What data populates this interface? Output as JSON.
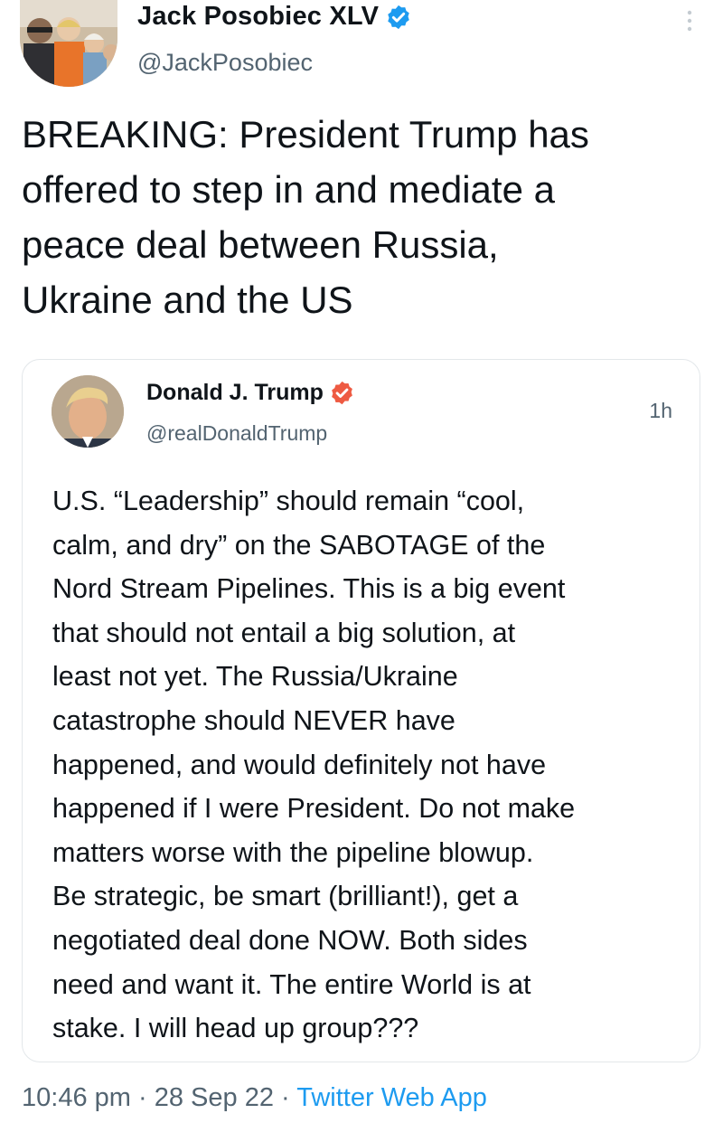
{
  "author": {
    "display_name": "Jack Posobiec XLV",
    "handle": "@JackPosobiec",
    "verified_icon": "verified-badge-icon"
  },
  "tweet": {
    "text": "BREAKING: President Trump has\noffered to step in and mediate a\npeace deal between Russia,\nUkraine and the US"
  },
  "quoted_tweet": {
    "display_name": "Donald J. Trump",
    "handle": "@realDonaldTrump",
    "time": "1h",
    "badge_icon": "truth-verified-badge-icon",
    "text": "U.S. “Leadership” should remain “cool,\ncalm, and dry” on the SABOTAGE of the\nNord Stream Pipelines. This is a big event\nthat should not entail a big solution, at\nleast not yet. The Russia/Ukraine\ncatastrophe should NEVER have\nhappened, and would definitely not have\nhappened if I were President. Do not make\nmatters worse with the pipeline blowup.\nBe strategic, be smart (brilliant!), get a\nnegotiated deal done NOW. Both sides\nneed and want it. The entire World is at\nstake. I will head up group???"
  },
  "footer": {
    "time": "10:46 pm",
    "separator": "·",
    "date": "28 Sep 22",
    "source": "Twitter Web App"
  },
  "colors": {
    "link_blue": "#1d9bf0",
    "muted_gray": "#536471",
    "truth_badge": "#ee5a42"
  }
}
